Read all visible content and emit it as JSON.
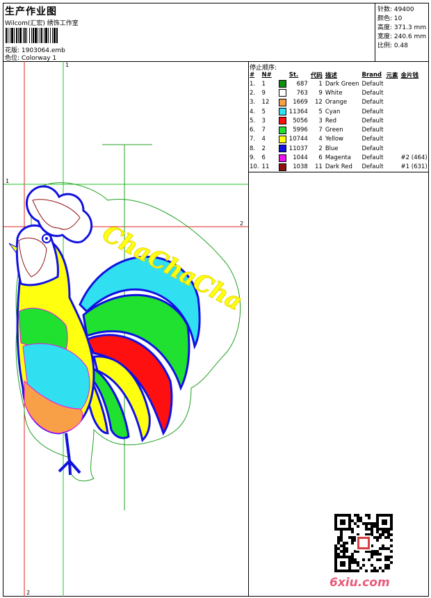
{
  "header": {
    "title": "生产作业图",
    "company": "Wilcom(汇宏) 绣饰工作室",
    "design_label": "花版:",
    "design_file": "1903064.emb",
    "color_label": "色位:",
    "colorway": "Colorway 1"
  },
  "stats": [
    {
      "label": "针数:",
      "value": "49400"
    },
    {
      "label": "颜色:",
      "value": "10"
    },
    {
      "label": "高度:",
      "value": "371.3 mm"
    },
    {
      "label": "宽度:",
      "value": "240.6 mm"
    },
    {
      "label": "比例:",
      "value": "0.48"
    }
  ],
  "sequence": {
    "title": "停止顺序:",
    "columns": [
      "#",
      "N#",
      "St.",
      "代码",
      "描述",
      "Brand",
      "元素",
      "金片钱"
    ],
    "rows": [
      {
        "idx": "1.",
        "n": "1",
        "color": "#109010",
        "st": "687",
        "code": "1",
        "desc": "Dark Green",
        "brand": "Default",
        "extra": ""
      },
      {
        "idx": "2.",
        "n": "9",
        "color": "#ffffff",
        "st": "763",
        "code": "9",
        "desc": "White",
        "brand": "Default",
        "extra": ""
      },
      {
        "idx": "3.",
        "n": "12",
        "color": "#f7a048",
        "st": "1669",
        "code": "12",
        "desc": "Orange",
        "brand": "Default",
        "extra": ""
      },
      {
        "idx": "4.",
        "n": "5",
        "color": "#30e0f0",
        "st": "11364",
        "code": "5",
        "desc": "Cyan",
        "brand": "Default",
        "extra": ""
      },
      {
        "idx": "5.",
        "n": "3",
        "color": "#ff1010",
        "st": "5056",
        "code": "3",
        "desc": "Red",
        "brand": "Default",
        "extra": ""
      },
      {
        "idx": "6.",
        "n": "7",
        "color": "#20e030",
        "st": "5996",
        "code": "7",
        "desc": "Green",
        "brand": "Default",
        "extra": ""
      },
      {
        "idx": "7.",
        "n": "4",
        "color": "#ffff10",
        "st": "10744",
        "code": "4",
        "desc": "Yellow",
        "brand": "Default",
        "extra": ""
      },
      {
        "idx": "8.",
        "n": "2",
        "color": "#1010e0",
        "st": "11037",
        "code": "2",
        "desc": "Blue",
        "brand": "Default",
        "extra": ""
      },
      {
        "idx": "9.",
        "n": "6",
        "color": "#f010f0",
        "st": "1044",
        "code": "6",
        "desc": "Magenta",
        "brand": "Default",
        "extra": "#2 (464)"
      },
      {
        "idx": "10.",
        "n": "11",
        "color": "#901010",
        "st": "1038",
        "code": "11",
        "desc": "Dark Red",
        "brand": "Default",
        "extra": "#1 (631)"
      }
    ]
  },
  "guides": {
    "top_1": "1",
    "left_1": "1",
    "right_2": "2",
    "bottom_2": "2"
  },
  "artwork_text": "ChaChaCha",
  "watermark": "6xiu.com"
}
